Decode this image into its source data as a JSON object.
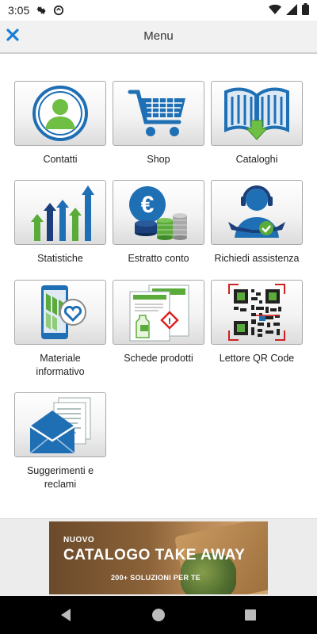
{
  "status_bar": {
    "time": "3:05"
  },
  "app_bar": {
    "title": "Menu"
  },
  "menu": {
    "contatti": "Contatti",
    "shop": "Shop",
    "cataloghi": "Cataloghi",
    "statistiche": "Statistiche",
    "estratto_conto": "Estratto conto",
    "richiedi_assistenza": "Richiedi assistenza",
    "materiale_informativo": "Materiale informativo",
    "schede_prodotti": "Schede prodotti",
    "lettore_qr": "Lettore QR Code",
    "suggerimenti": "Suggerimenti e reclami"
  },
  "banner": {
    "line1": "NUOVO",
    "line2": "CATALOGO TAKE AWAY",
    "line3": "200+ SOLUZIONI PER TE"
  },
  "colors": {
    "accent": "#1a7fd4",
    "icon_blue": "#1f6fb5",
    "icon_green": "#5aab3a"
  }
}
